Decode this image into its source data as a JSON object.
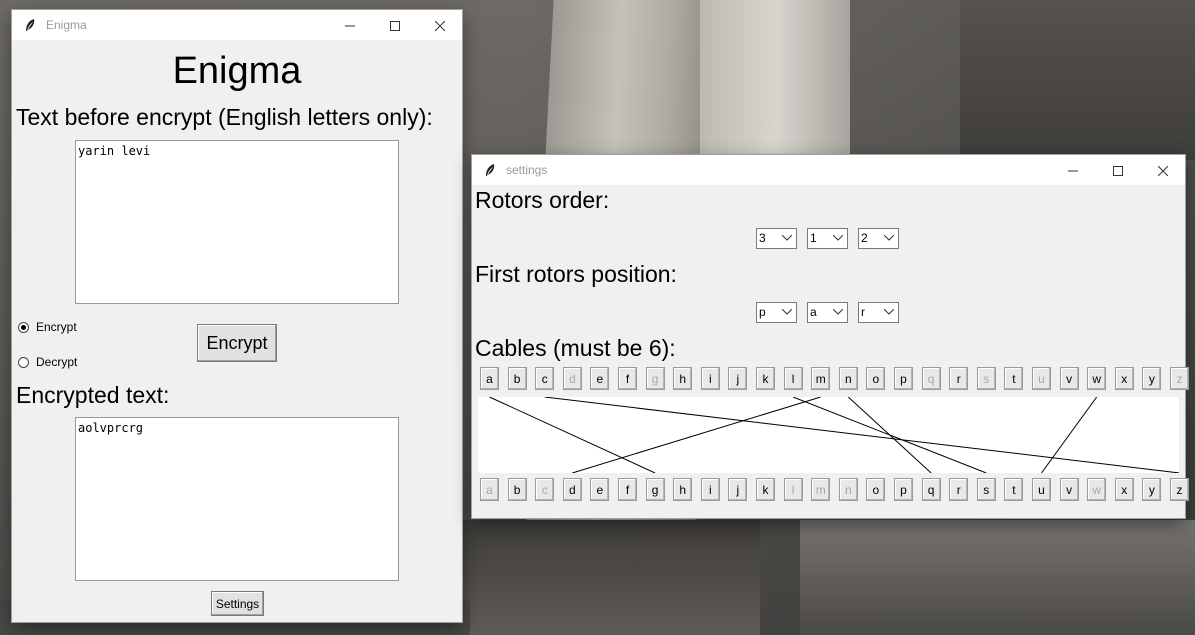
{
  "main_window": {
    "title": "Enigma",
    "heading": "Enigma",
    "input_label": "Text before encrypt (English letters only):",
    "input_text": "yarin levi",
    "mode_options": [
      {
        "label": "Encrypt",
        "selected": true
      },
      {
        "label": "Decrypt",
        "selected": false
      }
    ],
    "action_button": "Encrypt",
    "output_label": "Encrypted text:",
    "output_text": "aolvprcrg",
    "settings_button": "Settings"
  },
  "settings_window": {
    "title": "settings",
    "rotors_order_label": "Rotors order:",
    "rotors_order": [
      "3",
      "1",
      "2"
    ],
    "first_positions_label": "First rotors position:",
    "first_positions": [
      "p",
      "a",
      "r"
    ],
    "cables_label": "Cables (must be 6):",
    "top_keys": [
      {
        "letter": "a",
        "enabled": true
      },
      {
        "letter": "b",
        "enabled": true
      },
      {
        "letter": "c",
        "enabled": true
      },
      {
        "letter": "d",
        "enabled": false
      },
      {
        "letter": "e",
        "enabled": true
      },
      {
        "letter": "f",
        "enabled": true
      },
      {
        "letter": "g",
        "enabled": false
      },
      {
        "letter": "h",
        "enabled": true
      },
      {
        "letter": "i",
        "enabled": true
      },
      {
        "letter": "j",
        "enabled": true
      },
      {
        "letter": "k",
        "enabled": true
      },
      {
        "letter": "l",
        "enabled": true
      },
      {
        "letter": "m",
        "enabled": true
      },
      {
        "letter": "n",
        "enabled": true
      },
      {
        "letter": "o",
        "enabled": true
      },
      {
        "letter": "p",
        "enabled": true
      },
      {
        "letter": "q",
        "enabled": false
      },
      {
        "letter": "r",
        "enabled": true
      },
      {
        "letter": "s",
        "enabled": false
      },
      {
        "letter": "t",
        "enabled": true
      },
      {
        "letter": "u",
        "enabled": false
      },
      {
        "letter": "v",
        "enabled": true
      },
      {
        "letter": "w",
        "enabled": true
      },
      {
        "letter": "x",
        "enabled": true
      },
      {
        "letter": "y",
        "enabled": true
      },
      {
        "letter": "z",
        "enabled": false
      }
    ],
    "bottom_keys": [
      {
        "letter": "a",
        "enabled": false
      },
      {
        "letter": "b",
        "enabled": true
      },
      {
        "letter": "c",
        "enabled": false
      },
      {
        "letter": "d",
        "enabled": true
      },
      {
        "letter": "e",
        "enabled": true
      },
      {
        "letter": "f",
        "enabled": true
      },
      {
        "letter": "g",
        "enabled": true
      },
      {
        "letter": "h",
        "enabled": true
      },
      {
        "letter": "i",
        "enabled": true
      },
      {
        "letter": "j",
        "enabled": true
      },
      {
        "letter": "k",
        "enabled": true
      },
      {
        "letter": "l",
        "enabled": false
      },
      {
        "letter": "m",
        "enabled": false
      },
      {
        "letter": "n",
        "enabled": false
      },
      {
        "letter": "o",
        "enabled": true
      },
      {
        "letter": "p",
        "enabled": true
      },
      {
        "letter": "q",
        "enabled": true
      },
      {
        "letter": "r",
        "enabled": true
      },
      {
        "letter": "s",
        "enabled": true
      },
      {
        "letter": "t",
        "enabled": true
      },
      {
        "letter": "u",
        "enabled": true
      },
      {
        "letter": "v",
        "enabled": true
      },
      {
        "letter": "w",
        "enabled": false
      },
      {
        "letter": "x",
        "enabled": true
      },
      {
        "letter": "y",
        "enabled": true
      },
      {
        "letter": "z",
        "enabled": true
      }
    ],
    "cables": [
      {
        "from": "a",
        "to": "g"
      },
      {
        "from": "c",
        "to": "z"
      },
      {
        "from": "m",
        "to": "d"
      },
      {
        "from": "l",
        "to": "s"
      },
      {
        "from": "n",
        "to": "q"
      },
      {
        "from": "w",
        "to": "u"
      }
    ]
  },
  "icons": {
    "app_icon": "feather-icon",
    "minimize": "minimize-icon",
    "maximize": "maximize-icon",
    "close": "close-icon",
    "dropdown": "chevron-down-icon"
  }
}
